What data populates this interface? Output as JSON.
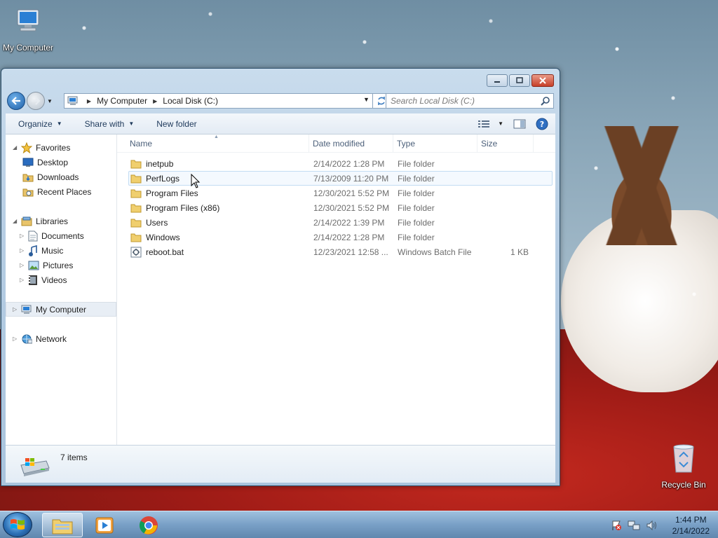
{
  "desktop": {
    "icons": [
      {
        "label": "My Computer"
      },
      {
        "label": "Recycle Bin"
      }
    ]
  },
  "window": {
    "address": {
      "crumbs": [
        "My Computer",
        "Local Disk (C:)"
      ]
    },
    "search": {
      "placeholder": "Search Local Disk (C:)"
    },
    "toolbar": {
      "organize": "Organize",
      "share_with": "Share with",
      "new_folder": "New folder"
    },
    "nav_pane": {
      "favorites": {
        "label": "Favorites",
        "items": [
          "Desktop",
          "Downloads",
          "Recent Places"
        ]
      },
      "libraries": {
        "label": "Libraries",
        "items": [
          "Documents",
          "Music",
          "Pictures",
          "Videos"
        ]
      },
      "computer": "My Computer",
      "network": "Network"
    },
    "columns": {
      "name": "Name",
      "date": "Date modified",
      "type": "Type",
      "size": "Size"
    },
    "files": [
      {
        "name": "inetpub",
        "date": "2/14/2022 1:28 PM",
        "type": "File folder",
        "size": ""
      },
      {
        "name": "PerfLogs",
        "date": "7/13/2009 11:20 PM",
        "type": "File folder",
        "size": ""
      },
      {
        "name": "Program Files",
        "date": "12/30/2021 5:52 PM",
        "type": "File folder",
        "size": ""
      },
      {
        "name": "Program Files (x86)",
        "date": "12/30/2021 5:52 PM",
        "type": "File folder",
        "size": ""
      },
      {
        "name": "Users",
        "date": "2/14/2022 1:39 PM",
        "type": "File folder",
        "size": ""
      },
      {
        "name": "Windows",
        "date": "2/14/2022 1:28 PM",
        "type": "File folder",
        "size": ""
      },
      {
        "name": "reboot.bat",
        "date": "12/23/2021 12:58 ...",
        "type": "Windows Batch File",
        "size": "1 KB"
      }
    ],
    "status": {
      "item_count": "7 items"
    }
  },
  "taskbar": {
    "time": "1:44 PM",
    "date": "2/14/2022"
  }
}
